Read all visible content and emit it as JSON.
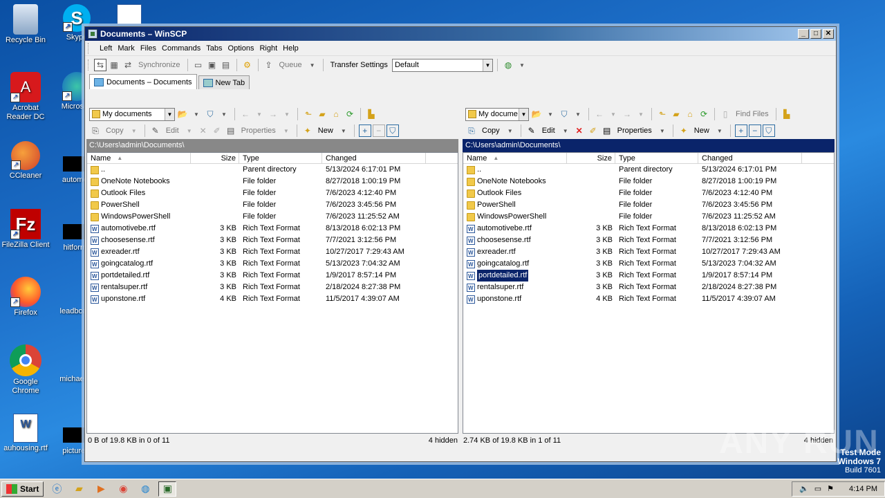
{
  "desktop": {
    "icons": [
      {
        "label": "Recycle Bin"
      },
      {
        "label": "Skype"
      },
      {
        "label": "Acrobat Reader DC"
      },
      {
        "label": "Microsoft"
      },
      {
        "label": "CCleaner"
      },
      {
        "label": "automoti"
      },
      {
        "label": "FileZilla Client"
      },
      {
        "label": "hitforms"
      },
      {
        "label": "Firefox"
      },
      {
        "label": "leadboard"
      },
      {
        "label": "Google Chrome"
      },
      {
        "label": "michaelca"
      },
      {
        "label": "auhousing.rtf"
      },
      {
        "label": "picturedi"
      }
    ]
  },
  "window": {
    "title": "Documents – WinSCP",
    "controls": {
      "minimize": "_",
      "maximize": "□",
      "close": "✕"
    }
  },
  "menu": [
    "Left",
    "Mark",
    "Files",
    "Commands",
    "Tabs",
    "Options",
    "Right",
    "Help"
  ],
  "toolbar": {
    "synchronize": "Synchronize",
    "queue": "Queue",
    "transfer_settings_label": "Transfer Settings",
    "transfer_settings_value": "Default"
  },
  "tabs": [
    {
      "label": "Documents – Documents",
      "active": true
    },
    {
      "label": "New Tab",
      "active": false
    }
  ],
  "left_panel": {
    "location": "My documents",
    "actions": {
      "copy": "Copy",
      "edit": "Edit",
      "properties": "Properties",
      "new": "New"
    },
    "path": "C:\\Users\\admin\\Documents\\",
    "columns": {
      "name": "Name",
      "size": "Size",
      "type": "Type",
      "changed": "Changed"
    },
    "status_left": "0 B of 19.8 KB in 0 of 11",
    "status_right": "4 hidden"
  },
  "right_panel": {
    "location": "My docume",
    "find_files": "Find Files",
    "actions": {
      "copy": "Copy",
      "edit": "Edit",
      "properties": "Properties",
      "new": "New"
    },
    "path": "C:\\Users\\admin\\Documents\\",
    "columns": {
      "name": "Name",
      "size": "Size",
      "type": "Type",
      "changed": "Changed"
    },
    "status_left": "2.74 KB of 19.8 KB in 1 of 11",
    "status_right": "4 hidden",
    "selected_file": "portdetailed.rtf"
  },
  "files": [
    {
      "name": "..",
      "size": "",
      "type": "Parent directory",
      "changed": "5/13/2024 6:17:01 PM",
      "icon": "parent"
    },
    {
      "name": "OneNote Notebooks",
      "size": "",
      "type": "File folder",
      "changed": "8/27/2018 1:00:19 PM",
      "icon": "folder"
    },
    {
      "name": "Outlook Files",
      "size": "",
      "type": "File folder",
      "changed": "7/6/2023 4:12:40 PM",
      "icon": "folder"
    },
    {
      "name": "PowerShell",
      "size": "",
      "type": "File folder",
      "changed": "7/6/2023 3:45:56 PM",
      "icon": "folder"
    },
    {
      "name": "WindowsPowerShell",
      "size": "",
      "type": "File folder",
      "changed": "7/6/2023 11:25:52 AM",
      "icon": "folder"
    },
    {
      "name": "automotivebe.rtf",
      "size": "3 KB",
      "type": "Rich Text Format",
      "changed": "8/13/2018 6:02:13 PM",
      "icon": "doc"
    },
    {
      "name": "choosesense.rtf",
      "size": "3 KB",
      "type": "Rich Text Format",
      "changed": "7/7/2021 3:12:56 PM",
      "icon": "doc"
    },
    {
      "name": "exreader.rtf",
      "size": "3 KB",
      "type": "Rich Text Format",
      "changed": "10/27/2017 7:29:43 AM",
      "icon": "doc"
    },
    {
      "name": "goingcatalog.rtf",
      "size": "3 KB",
      "type": "Rich Text Format",
      "changed": "5/13/2023 7:04:32 AM",
      "icon": "doc"
    },
    {
      "name": "portdetailed.rtf",
      "size": "3 KB",
      "type": "Rich Text Format",
      "changed": "1/9/2017 8:57:14 PM",
      "icon": "doc"
    },
    {
      "name": "rentalsuper.rtf",
      "size": "3 KB",
      "type": "Rich Text Format",
      "changed": "2/18/2024 8:27:38 PM",
      "icon": "doc"
    },
    {
      "name": "uponstone.rtf",
      "size": "4 KB",
      "type": "Rich Text Format",
      "changed": "11/5/2017 4:39:07 AM",
      "icon": "doc"
    }
  ],
  "watermark": "ANY RUN",
  "os": {
    "line1": "Test Mode",
    "line2": "Windows 7",
    "line3": "Build 7601"
  },
  "taskbar": {
    "start": "Start",
    "clock": "4:14 PM"
  }
}
